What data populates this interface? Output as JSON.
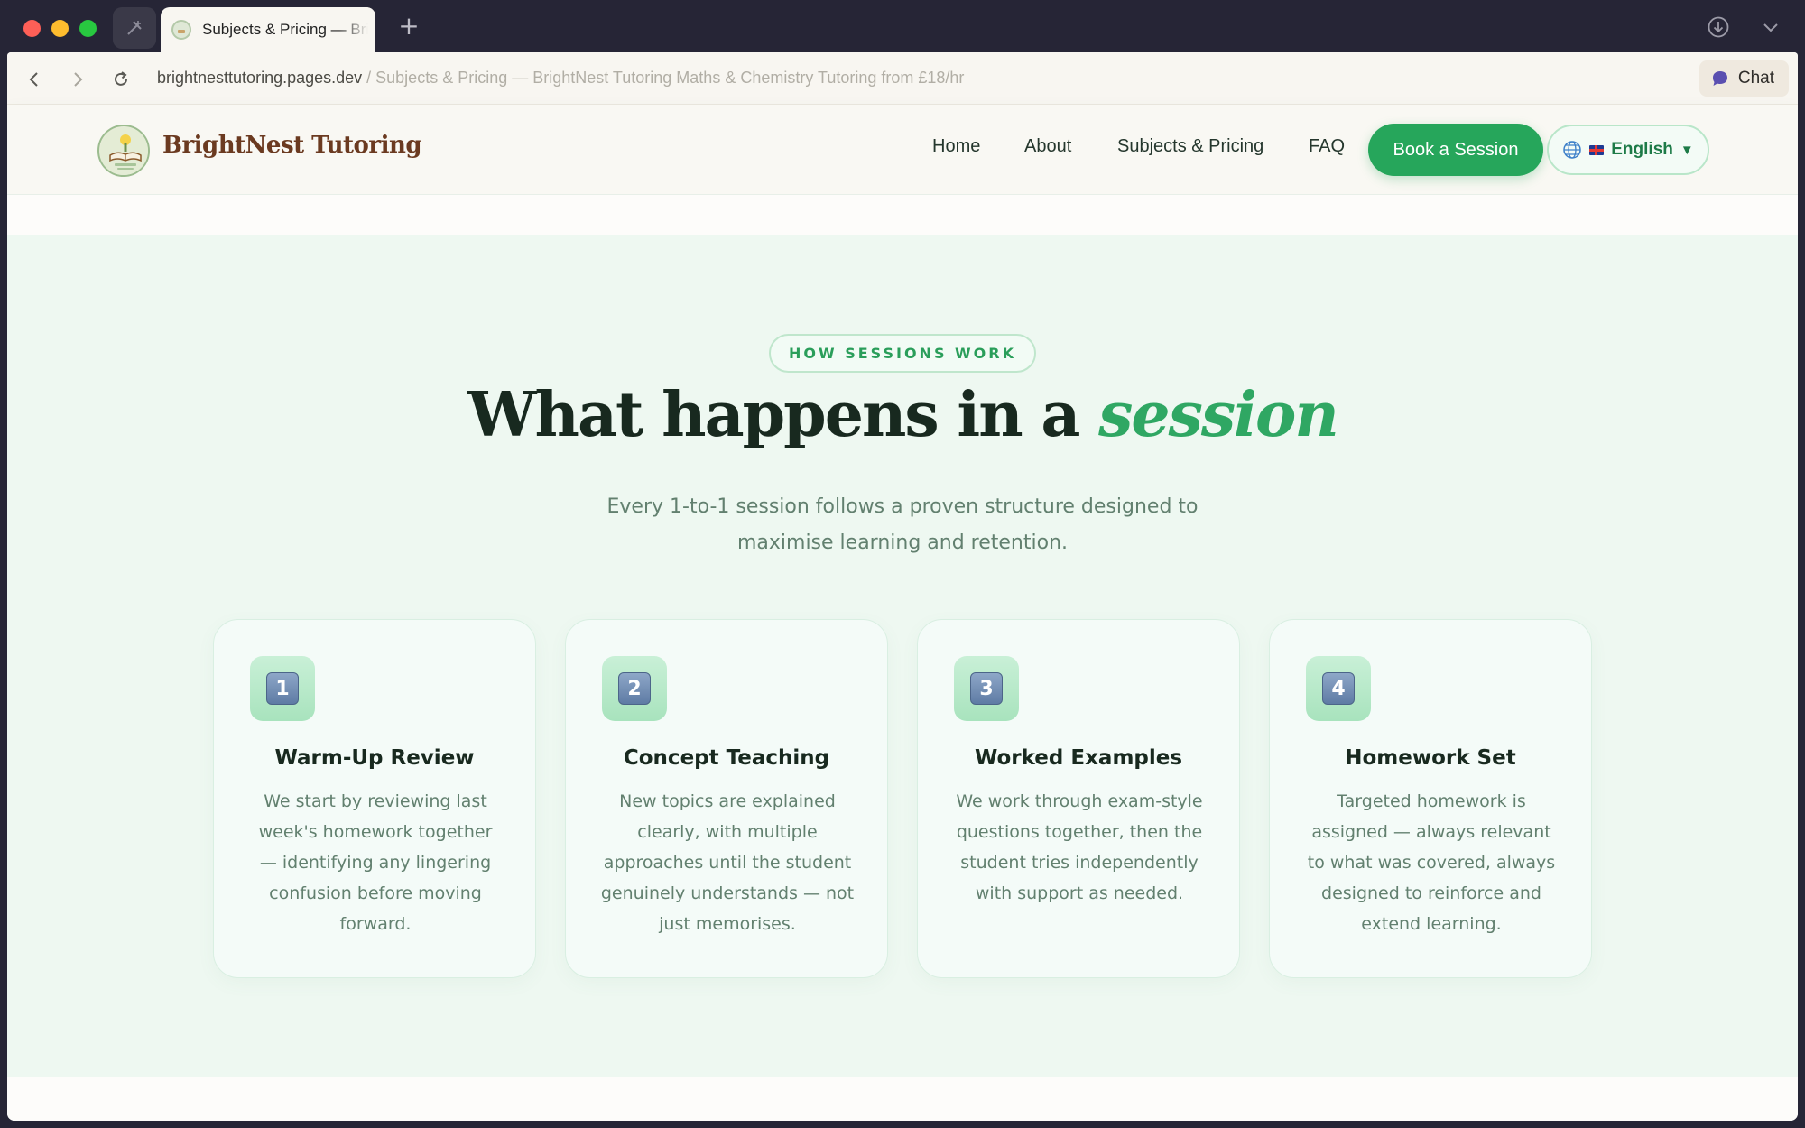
{
  "browser": {
    "tab_title": "Subjects & Pricing — BrightNest Tutoring",
    "new_tab_symbol": "+",
    "url_domain": "brightnesttutoring.pages.dev",
    "url_path": " / Subjects & Pricing — BrightNest Tutoring Maths & Chemistry Tutoring from £18/hr",
    "chat_label": "Chat"
  },
  "header": {
    "brand": "BrightNest Tutoring",
    "nav": [
      "Home",
      "About",
      "Subjects & Pricing",
      "FAQ"
    ],
    "cta": "Book a Session",
    "language": "English",
    "language_caret": "▼"
  },
  "section": {
    "eyebrow": "HOW SESSIONS WORK",
    "headline_main": "What happens in a ",
    "headline_accent": "session",
    "subtitle": "Every 1-to-1 session follows a proven structure designed to maximise learning and retention.",
    "steps": [
      {
        "number": "1",
        "title": "Warm-Up Review",
        "text": "We start by reviewing last week's homework together — identifying any lingering confusion before moving forward."
      },
      {
        "number": "2",
        "title": "Concept Teaching",
        "text": "New topics are explained clearly, with multiple approaches until the student genuinely understands — not just memorises."
      },
      {
        "number": "3",
        "title": "Worked Examples",
        "text": "We work through exam-style questions together, then the student tries independently with support as needed."
      },
      {
        "number": "4",
        "title": "Homework Set",
        "text": "Targeted homework is assigned — always relevant to what was covered, always designed to reinforce and extend learning."
      }
    ]
  },
  "colors": {
    "accent_green": "#26a65b",
    "brand_brown": "#6b3a20",
    "section_bg": "#eef8f1",
    "heading": "#18291f"
  },
  "icons": [
    "sidebar-toggle-icon",
    "new-tab-icon",
    "download-icon",
    "tab-list-chevron-icon",
    "back-icon",
    "forward-icon",
    "reload-icon",
    "chat-bubble-icon",
    "logo-icon",
    "globe-icon"
  ]
}
